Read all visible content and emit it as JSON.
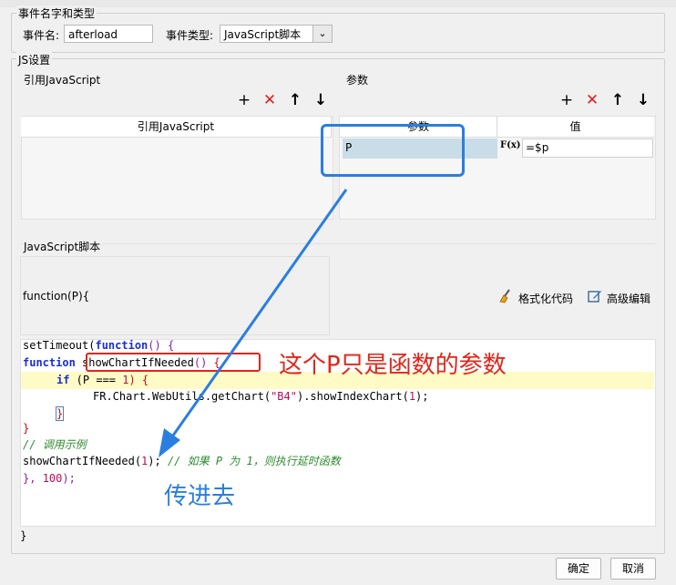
{
  "event_section": {
    "legend": "事件名字和类型",
    "name_label": "事件名:",
    "name_value": "afterload",
    "type_label": "事件类型:",
    "type_value": "JavaScript脚本"
  },
  "js_section": {
    "legend": "JS设置",
    "ref_title": "引用JavaScript",
    "ref_column": "引用JavaScript",
    "params_title": "参数",
    "params_columns": [
      "参数",
      "值"
    ],
    "params_rows": [
      {
        "name": "P",
        "value": "=$p"
      }
    ],
    "fx_label": "F(x)"
  },
  "script_section": {
    "title": "JavaScript脚本",
    "function_header": "function(P){",
    "format_label": "格式化代码",
    "advanced_label": "高级编辑",
    "closing": "}"
  },
  "code_tokens": {
    "l1a": "setTimeout(",
    "l1b": "function",
    "l1c": "() {",
    "l2a": "function",
    "l2b": " showChartIfNeeded",
    "l2c": "()",
    "l2d": " {",
    "l3a": "if",
    "l3b": " (P === ",
    "l3c": "1",
    "l3d": ") {",
    "l4a": "FR.Chart.WebUtils.getChart(",
    "l4b": "\"B4\"",
    "l4c": ").showIndexChart(",
    "l4d": "1",
    "l4e": ");",
    "l5": "}",
    "l6": "}",
    "l7": "// 调用示例",
    "l8a": "showChartIfNeeded(",
    "l8b": "1",
    "l8c": ");",
    "l8d": " // 如果 P 为 1，则执行延时函数",
    "l9a": "}, ",
    "l9b": "100",
    "l9c": ");"
  },
  "annotations": {
    "param_note": "这个P只是函数的参数",
    "pass_note": "传进去"
  },
  "footer": {
    "ok": "确定",
    "cancel": "取消"
  },
  "colors": {
    "annotation_red": "#e0261b",
    "annotation_blue": "#2a7ee0",
    "highlight_line": "#fffbc6",
    "selected_cell": "#c9dde8"
  }
}
